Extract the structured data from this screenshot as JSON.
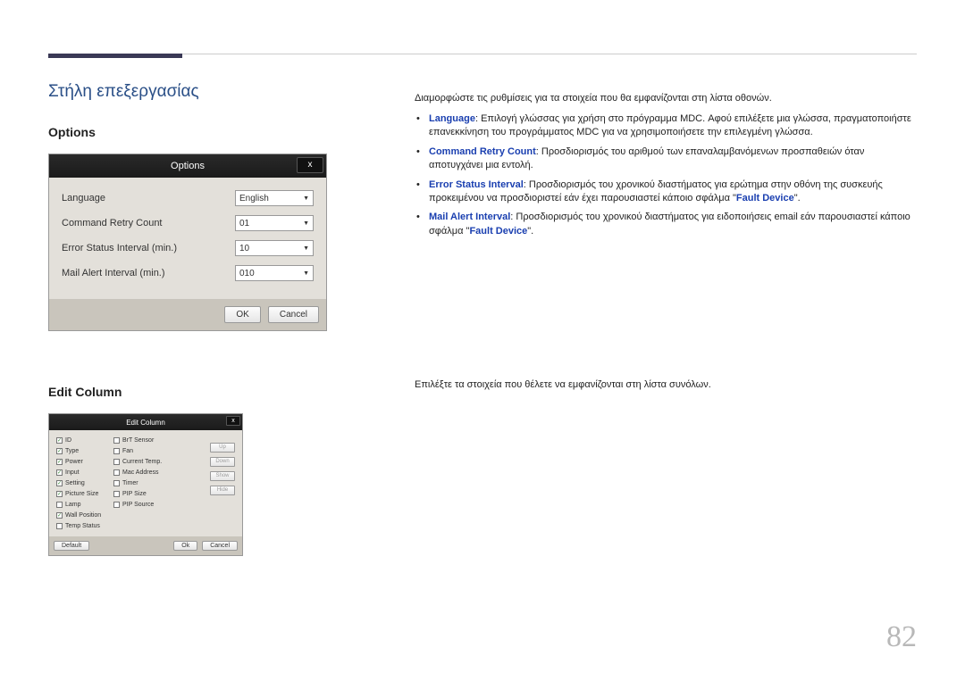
{
  "page_number": "82",
  "section_title": "Στήλη επεξεργασίας",
  "options": {
    "heading": "Options",
    "dialog_title": "Options",
    "close": "x",
    "rows": {
      "language_label": "Language",
      "language_value": "English",
      "retry_label": "Command Retry Count",
      "retry_value": "01",
      "error_label": "Error Status Interval (min.)",
      "error_value": "10",
      "mail_label": "Mail Alert Interval (min.)",
      "mail_value": "010"
    },
    "ok": "OK",
    "cancel": "Cancel"
  },
  "editcol": {
    "heading": "Edit Column",
    "dialog_title": "Edit Column",
    "close": "x",
    "col1": [
      {
        "c": true,
        "t": "ID"
      },
      {
        "c": true,
        "t": "Type"
      },
      {
        "c": true,
        "t": "Power"
      },
      {
        "c": true,
        "t": "Input"
      },
      {
        "c": true,
        "t": "Setting"
      },
      {
        "c": true,
        "t": "Picture Size"
      },
      {
        "c": false,
        "t": "Lamp"
      },
      {
        "c": true,
        "t": "Wall Position"
      },
      {
        "c": false,
        "t": "Temp Status"
      }
    ],
    "col2": [
      {
        "c": false,
        "t": "BrT Sensor"
      },
      {
        "c": false,
        "t": "Fan"
      },
      {
        "c": false,
        "t": "Current Temp."
      },
      {
        "c": false,
        "t": "Mac Address"
      },
      {
        "c": false,
        "t": "Timer"
      },
      {
        "c": false,
        "t": "PIP Size"
      },
      {
        "c": false,
        "t": "PIP Source"
      }
    ],
    "sidebtns": [
      "Up",
      "Down",
      "Show",
      "Hide"
    ],
    "default": "Default",
    "ok": "Ok",
    "cancel": "Cancel"
  },
  "right": {
    "intro": "Διαμορφώστε τις ρυθμίσεις για τα στοιχεία που θα εμφανίζονται στη λίστα οθονών.",
    "b1_key": "Language",
    "b1_rest": ": Επιλογή γλώσσας για χρήση στο πρόγραμμα MDC. Αφού επιλέξετε μια γλώσσα, πραγματοποιήστε επανεκκίνηση του προγράμματος MDC για να χρησιμοποιήσετε την επιλεγμένη γλώσσα.",
    "b2_key": "Command Retry Count",
    "b2_rest": ": Προσδιορισμός του αριθμού των επαναλαμβανόμενων προσπαθειών όταν αποτυγχάνει μια εντολή.",
    "b3_key": "Error Status Interval",
    "b3_mid": ": Προσδιορισμός του χρονικού διαστήματος για ερώτημα στην οθόνη της συσκευής προκειμένου να προσδιοριστεί εάν έχει παρουσιαστεί κάποιο σφάλμα \"",
    "b3_fd": "Fault Device",
    "b3_end": "\".",
    "b4_key": "Mail Alert Interval",
    "b4_mid": ": Προσδιορισμός του χρονικού διαστήματος για ειδοποιήσεις email εάν παρουσιαστεί κάποιο σφάλμα \"",
    "b4_fd": "Fault Device",
    "b4_end": "\".",
    "edit_intro": "Επιλέξτε τα στοιχεία που θέλετε να εμφανίζονται στη λίστα συνόλων."
  }
}
